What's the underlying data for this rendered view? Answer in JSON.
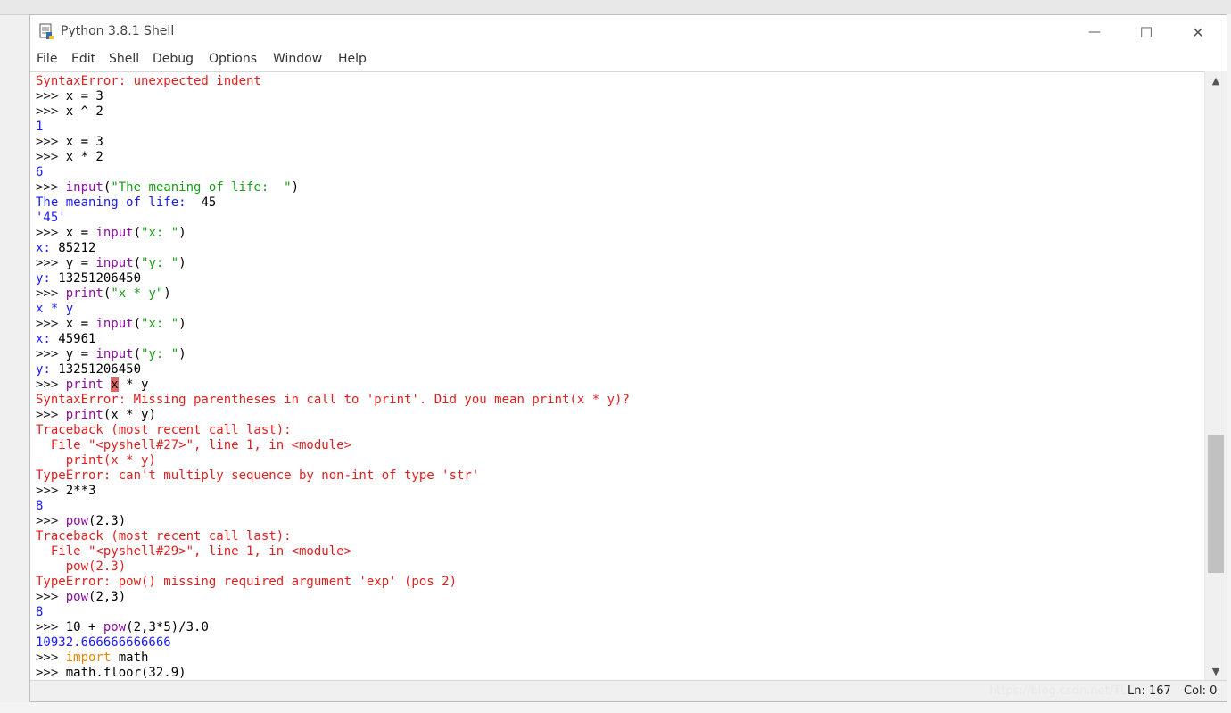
{
  "window": {
    "title": "Python 3.8.1 Shell",
    "minimize_glyph": "—",
    "maximize_glyph": "☐",
    "close_glyph": "✕"
  },
  "menu": [
    "File",
    "Edit",
    "Shell",
    "Debug",
    "Options",
    "Window",
    "Help"
  ],
  "colors": {
    "prompt": "#222222",
    "output_blue": "#1a1aff",
    "error_red": "#e02020",
    "keyword_purple": "#8a0e9e",
    "string_green": "#1a9b1a",
    "keyword_orange": "#e88a00",
    "default": "#000000"
  },
  "shell_lines": [
    [
      {
        "t": "SyntaxError: unexpected indent",
        "c": "error_red"
      }
    ],
    [
      {
        "t": ">>> ",
        "c": "prompt"
      },
      {
        "t": "x = 3",
        "c": "default"
      }
    ],
    [
      {
        "t": ">>> ",
        "c": "prompt"
      },
      {
        "t": "x ^ 2",
        "c": "default"
      }
    ],
    [
      {
        "t": "1",
        "c": "output_blue"
      }
    ],
    [
      {
        "t": ">>> ",
        "c": "prompt"
      },
      {
        "t": "x = 3",
        "c": "default"
      }
    ],
    [
      {
        "t": ">>> ",
        "c": "prompt"
      },
      {
        "t": "x * 2",
        "c": "default"
      }
    ],
    [
      {
        "t": "6",
        "c": "output_blue"
      }
    ],
    [
      {
        "t": ">>> ",
        "c": "prompt"
      },
      {
        "t": "input",
        "c": "keyword_purple"
      },
      {
        "t": "(",
        "c": "default"
      },
      {
        "t": "\"The meaning of life:  \"",
        "c": "string_green"
      },
      {
        "t": ")",
        "c": "default"
      }
    ],
    [
      {
        "t": "The meaning of life:  ",
        "c": "output_blue"
      },
      {
        "t": "45",
        "c": "default"
      }
    ],
    [
      {
        "t": "'45'",
        "c": "output_blue"
      }
    ],
    [
      {
        "t": ">>> ",
        "c": "prompt"
      },
      {
        "t": "x = ",
        "c": "default"
      },
      {
        "t": "input",
        "c": "keyword_purple"
      },
      {
        "t": "(",
        "c": "default"
      },
      {
        "t": "\"x: \"",
        "c": "string_green"
      },
      {
        "t": ")",
        "c": "default"
      }
    ],
    [
      {
        "t": "x: ",
        "c": "output_blue"
      },
      {
        "t": "85212",
        "c": "default"
      }
    ],
    [
      {
        "t": ">>> ",
        "c": "prompt"
      },
      {
        "t": "y = ",
        "c": "default"
      },
      {
        "t": "input",
        "c": "keyword_purple"
      },
      {
        "t": "(",
        "c": "default"
      },
      {
        "t": "\"y: \"",
        "c": "string_green"
      },
      {
        "t": ")",
        "c": "default"
      }
    ],
    [
      {
        "t": "y: ",
        "c": "output_blue"
      },
      {
        "t": "13251206450",
        "c": "default"
      }
    ],
    [
      {
        "t": ">>> ",
        "c": "prompt"
      },
      {
        "t": "print",
        "c": "keyword_purple"
      },
      {
        "t": "(",
        "c": "default"
      },
      {
        "t": "\"x * y\"",
        "c": "string_green"
      },
      {
        "t": ")",
        "c": "default"
      }
    ],
    [
      {
        "t": "x * y",
        "c": "output_blue"
      }
    ],
    [
      {
        "t": ">>> ",
        "c": "prompt"
      },
      {
        "t": "x = ",
        "c": "default"
      },
      {
        "t": "input",
        "c": "keyword_purple"
      },
      {
        "t": "(",
        "c": "default"
      },
      {
        "t": "\"x: \"",
        "c": "string_green"
      },
      {
        "t": ")",
        "c": "default"
      }
    ],
    [
      {
        "t": "x: ",
        "c": "output_blue"
      },
      {
        "t": "45961",
        "c": "default"
      }
    ],
    [
      {
        "t": ">>> ",
        "c": "prompt"
      },
      {
        "t": "y = ",
        "c": "default"
      },
      {
        "t": "input",
        "c": "keyword_purple"
      },
      {
        "t": "(",
        "c": "default"
      },
      {
        "t": "\"y: \"",
        "c": "string_green"
      },
      {
        "t": ")",
        "c": "default"
      }
    ],
    [
      {
        "t": "y: ",
        "c": "output_blue"
      },
      {
        "t": "13251206450",
        "c": "default"
      }
    ],
    [
      {
        "t": ">>> ",
        "c": "prompt"
      },
      {
        "t": "print ",
        "c": "keyword_purple"
      },
      {
        "t": "x",
        "c": "cursor"
      },
      {
        "t": " * y",
        "c": "default"
      }
    ],
    [
      {
        "t": "SyntaxError: Missing parentheses in call to 'print'. Did you mean print(x * y)?",
        "c": "error_red"
      }
    ],
    [
      {
        "t": ">>> ",
        "c": "prompt"
      },
      {
        "t": "print",
        "c": "keyword_purple"
      },
      {
        "t": "(x * y)",
        "c": "default"
      }
    ],
    [
      {
        "t": "Traceback (most recent call last):",
        "c": "error_red"
      }
    ],
    [
      {
        "t": "  File \"<pyshell#27>\", line 1, in <module>",
        "c": "error_red"
      }
    ],
    [
      {
        "t": "    print(x * y)",
        "c": "error_red"
      }
    ],
    [
      {
        "t": "TypeError: can't multiply sequence by non-int of type 'str'",
        "c": "error_red"
      }
    ],
    [
      {
        "t": ">>> ",
        "c": "prompt"
      },
      {
        "t": "2**3",
        "c": "default"
      }
    ],
    [
      {
        "t": "8",
        "c": "output_blue"
      }
    ],
    [
      {
        "t": ">>> ",
        "c": "prompt"
      },
      {
        "t": "pow",
        "c": "keyword_purple"
      },
      {
        "t": "(2.3)",
        "c": "default"
      }
    ],
    [
      {
        "t": "Traceback (most recent call last):",
        "c": "error_red"
      }
    ],
    [
      {
        "t": "  File \"<pyshell#29>\", line 1, in <module>",
        "c": "error_red"
      }
    ],
    [
      {
        "t": "    pow(2.3)",
        "c": "error_red"
      }
    ],
    [
      {
        "t": "TypeError: pow() missing required argument 'exp' (pos 2)",
        "c": "error_red"
      }
    ],
    [
      {
        "t": ">>> ",
        "c": "prompt"
      },
      {
        "t": "pow",
        "c": "keyword_purple"
      },
      {
        "t": "(2,3)",
        "c": "default"
      }
    ],
    [
      {
        "t": "8",
        "c": "output_blue"
      }
    ],
    [
      {
        "t": ">>> ",
        "c": "prompt"
      },
      {
        "t": "10 + ",
        "c": "default"
      },
      {
        "t": "pow",
        "c": "keyword_purple"
      },
      {
        "t": "(2,3*5)/3.0",
        "c": "default"
      }
    ],
    [
      {
        "t": "10932.666666666666",
        "c": "output_blue"
      }
    ],
    [
      {
        "t": ">>> ",
        "c": "prompt"
      },
      {
        "t": "import",
        "c": "keyword_orange"
      },
      {
        "t": " math",
        "c": "default"
      }
    ],
    [
      {
        "t": ">>> ",
        "c": "prompt"
      },
      {
        "t": "math.floor(32.9)",
        "c": "default"
      }
    ]
  ],
  "status": {
    "watermark": "https://blog.csdn.net/TLC...",
    "ln": "Ln: 167",
    "col": "Col: 0"
  },
  "scrollbar": {
    "up_glyph": "▲",
    "down_glyph": "▼"
  }
}
